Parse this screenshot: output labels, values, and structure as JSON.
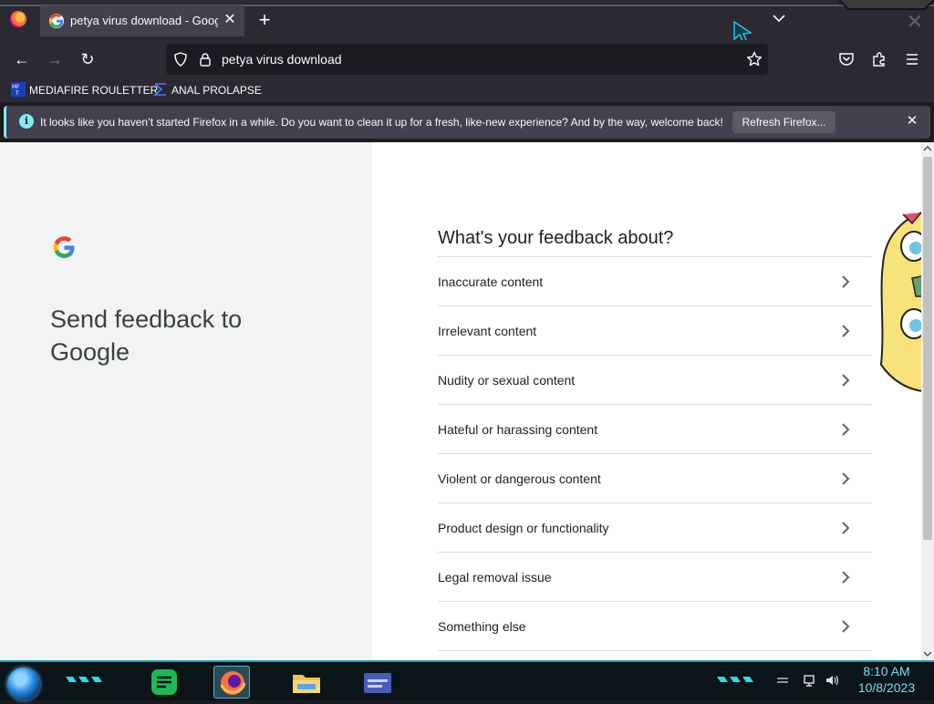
{
  "browser": {
    "tab": {
      "title": "petya virus download - Google",
      "close": "✕"
    },
    "new_tab": "+",
    "url": "petya virus download",
    "nav": {
      "back": "←",
      "forward": "→",
      "reload": "↻"
    }
  },
  "bookmarks": [
    {
      "label": "MEDIAFIRE ROULETTER",
      "icon": "mediafire-icon"
    },
    {
      "label": "ANAL PROLAPSE",
      "icon": "bookmark-icon"
    }
  ],
  "notification": {
    "text": "It looks like you haven’t started Firefox in a while. Do you want to clean it up for a fresh, like-new experience? And by the way, welcome back!",
    "button": "Refresh Firefox...",
    "info": "i",
    "close": "✕"
  },
  "feedback": {
    "heading": "Send feedback to Google",
    "question": "What's your feedback about?",
    "close": "✕",
    "options": [
      "Inaccurate content",
      "Irrelevant content",
      "Nudity or sexual content",
      "Hateful or harassing content",
      "Violent or dangerous content",
      "Product design or functionality",
      "Legal removal issue",
      "Something else"
    ]
  },
  "taskbar": {
    "time": "8:10 AM",
    "date": "10/8/2023"
  },
  "colors": {
    "browser_bg": "#2b2a33",
    "tab_active": "#42414d",
    "notice_accent": "#80ebff",
    "google_blue": "#4285f4",
    "google_red": "#ea4335",
    "google_yellow": "#fbbc05",
    "google_green": "#34a853",
    "taskbar_accent": "#1aa3b8",
    "clock_text": "#6ee0ff"
  }
}
